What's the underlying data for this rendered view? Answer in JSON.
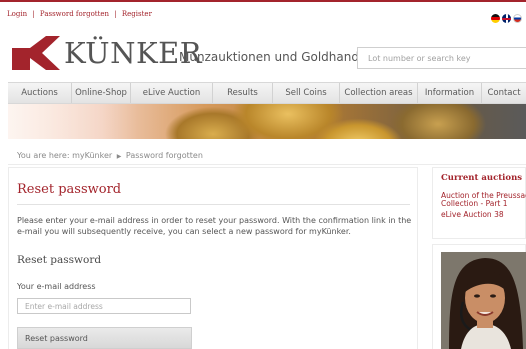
{
  "top": {
    "login_label": "Login",
    "separator": "|",
    "password_forgotten_label": "Password forgotten",
    "register_label": "Register",
    "flags": [
      "german-flag-icon",
      "uk-flag-icon",
      "russian-flag-icon"
    ]
  },
  "header": {
    "brand_name": "KÜNKER",
    "tagline": "Münzauktionen und Goldhandel",
    "search_placeholder": "Lot number or search key"
  },
  "nav": {
    "items": [
      {
        "label": "Auctions"
      },
      {
        "label": "Online-Shop"
      },
      {
        "label": "eLive Auction"
      },
      {
        "label": "Results"
      },
      {
        "label": "Sell Coins"
      },
      {
        "label": "Collection areas"
      },
      {
        "label": "Information"
      },
      {
        "label": "Contact"
      }
    ]
  },
  "breadcrumb": {
    "prefix": "You are here:",
    "parent": "myKünker",
    "current": "Password forgotten"
  },
  "main": {
    "title": "Reset password",
    "intro": "Please enter your e-mail address in order to reset your password. With the confirmation link in the e-mail you will subsequently receive, you can select a new password for myKünker.",
    "subtitle": "Reset password",
    "email_label": "Your e-mail address",
    "email_placeholder": "Enter e-mail address",
    "submit_label": "Reset password"
  },
  "sidebar": {
    "current_title": "Current auctions",
    "links": [
      {
        "label": "Auction of the Preussag Collection - Part 1"
      },
      {
        "label": "eLive Auction 38"
      }
    ]
  },
  "colors": {
    "brand_red": "#a3242c",
    "text_grey": "#4a4a4a",
    "nav_bg": "#e8e8e8"
  }
}
